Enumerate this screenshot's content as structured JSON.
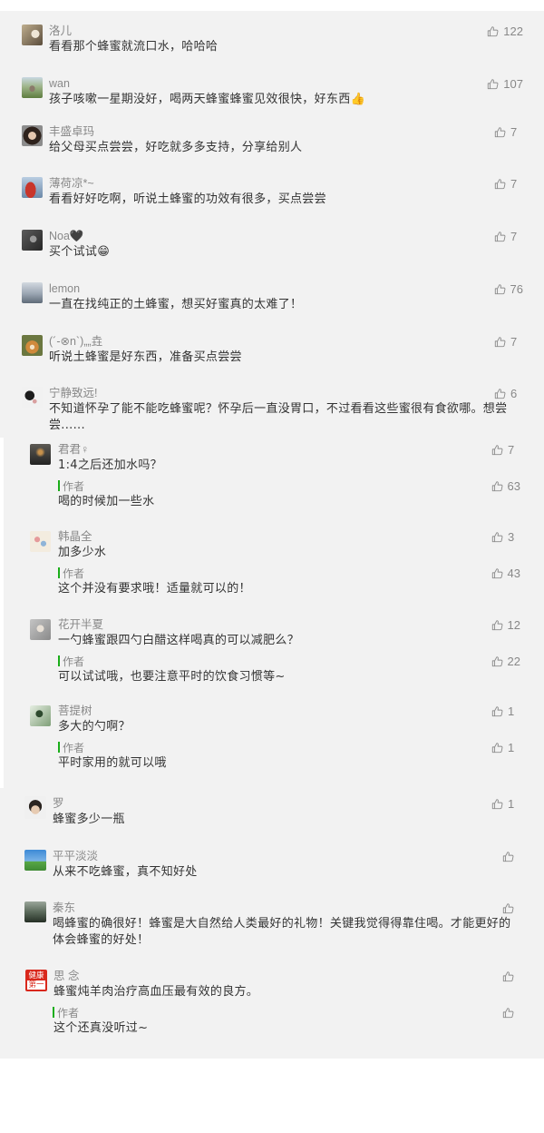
{
  "comments": [
    {
      "name": "洛儿",
      "text": "看看那个蜂蜜就流口水，哈哈哈",
      "likes": "122"
    },
    {
      "name": "wan",
      "text": "孩子咳嗽一星期没好，喝两天蜂蜜蜂蜜见效很快，好东西👍",
      "likes": "107"
    },
    {
      "name": "丰盛卓玛",
      "text": "给父母买点尝尝，好吃就多多支持，分享给别人",
      "likes": "7"
    },
    {
      "name": "薄荷凉*~",
      "text": "看看好好吃啊，听说土蜂蜜的功效有很多，买点尝尝",
      "likes": "7"
    },
    {
      "name": "Noa🖤",
      "text": "买个试试😁",
      "likes": "7"
    },
    {
      "name": "lemon",
      "text": "一直在找纯正的土蜂蜜，想买好蜜真的太难了！",
      "likes": "76"
    },
    {
      "name": "(´-⊗n`)„„垚",
      "text": "听说土蜂蜜是好东西，准备买点尝尝",
      "likes": "7"
    },
    {
      "name": "宁静致远!",
      "text": "不知道怀孕了能不能吃蜂蜜呢？怀孕后一直没胃口，不过看看这些蜜很有食欲哪。想尝尝......",
      "likes": "6"
    },
    {
      "name": "君君♀",
      "text": "1:4之后还加水吗？",
      "likes": "7",
      "author_reply": {
        "label": "作者",
        "text": "喝的时候加一些水",
        "likes": "63"
      }
    },
    {
      "name": "韩晶全",
      "text": "加多少水",
      "likes": "3",
      "author_reply": {
        "label": "作者",
        "text": "这个并没有要求哦！适量就可以的！",
        "likes": "43"
      }
    },
    {
      "name": "花开半夏",
      "text": "一勺蜂蜜跟四勺白醋这样喝真的可以减肥么？",
      "likes": "12",
      "author_reply": {
        "label": "作者",
        "text": "可以试试哦，也要注意平时的饮食习惯等~",
        "likes": "22"
      }
    },
    {
      "name": "菩提树",
      "text": "多大的勺啊？",
      "likes": "1",
      "author_reply": {
        "label": "作者",
        "text": "平时家用的就可以哦",
        "likes": "1"
      }
    },
    {
      "name": "罗",
      "text": "蜂蜜多少一瓶",
      "likes": "1"
    },
    {
      "name": "平平淡淡",
      "text": "从来不吃蜂蜜，真不知好处"
    },
    {
      "name": "秦东",
      "text": "喝蜂蜜的确很好！蜂蜜是大自然给人类最好的礼物！关键我觉得得靠住喝。才能更好的体会蜂蜜的好处！"
    },
    {
      "name": "思 念",
      "avatar_text": [
        "健康",
        "第一"
      ],
      "text": "蜂蜜炖羊肉治疗高血压最有效的良方。",
      "author_reply": {
        "label": "作者",
        "text": "这个还真没听过~"
      }
    }
  ],
  "icons": {
    "like": "thumbs-up-icon",
    "author_marker": "green-bar"
  },
  "colors": {
    "background": "#f2f2f2",
    "author_bar": "#1aad19",
    "name": "#888888",
    "text": "#333333"
  }
}
